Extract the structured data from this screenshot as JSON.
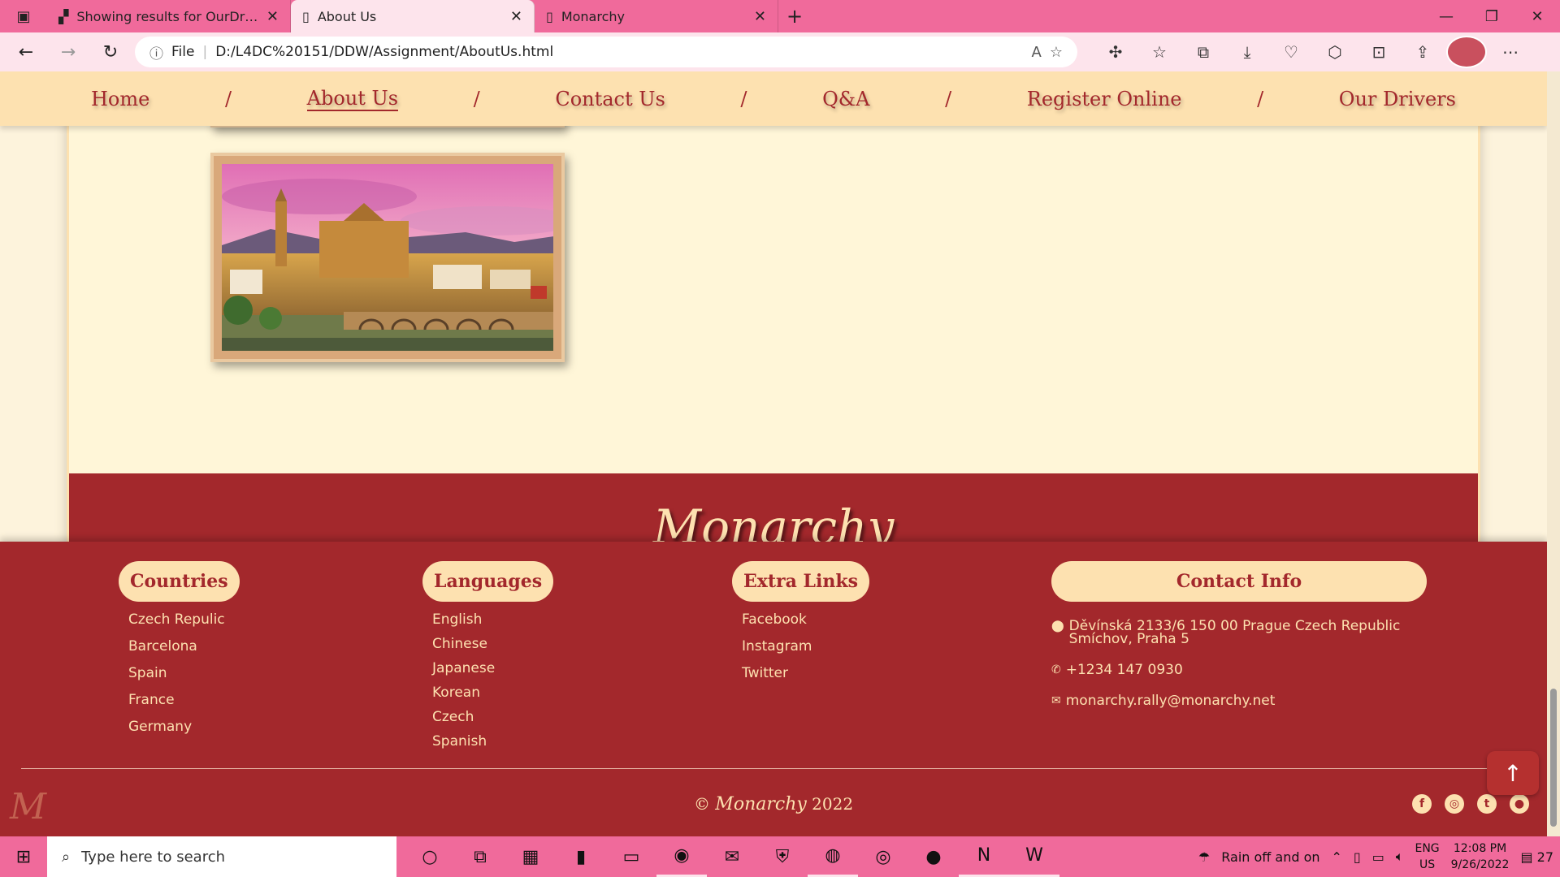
{
  "browser": {
    "tabs": [
      {
        "title": "Showing results for OurDrivers.h",
        "active": false
      },
      {
        "title": "About Us",
        "active": true
      },
      {
        "title": "Monarchy",
        "active": false
      }
    ],
    "address": {
      "label": "File",
      "url": "D:/L4DC%20151/DDW/Assignment/AboutUs.html"
    }
  },
  "nav": {
    "items": [
      "Home",
      "About Us",
      "Contact Us",
      "Q&A",
      "Register Online",
      "Our Drivers"
    ],
    "separator": "/",
    "current": "About Us"
  },
  "band": {
    "brand": "Monarchy"
  },
  "footer": {
    "countries": {
      "heading": "Countries",
      "items": [
        "Czech Repulic",
        "Barcelona",
        "Spain",
        "France",
        "Germany"
      ]
    },
    "languages": {
      "heading": "Languages",
      "items": [
        "English",
        "Chinese",
        "Japanese",
        "Korean",
        "Czech",
        "Spanish"
      ]
    },
    "links": {
      "heading": "Extra Links",
      "items": [
        "Facebook",
        "Instagram",
        "Twitter"
      ]
    },
    "contact": {
      "heading": "Contact Info",
      "address_line1": "Děvínská 2133/6 150 00 Prague Czech Republic",
      "address_line2": "Smíchov, Praha 5",
      "phone": "+1234 147 0930",
      "email": "monarchy.rally@monarchy.net"
    },
    "copyright": {
      "symbol": "©",
      "brand": "Monarchy",
      "year": "2022"
    },
    "logo": "M"
  },
  "taskbar": {
    "search_placeholder": "Type here to search",
    "weather": "Rain off and on",
    "lang_top": "ENG",
    "lang_bottom": "US",
    "time": "12:08 PM",
    "date": "9/26/2022",
    "notification_count": "27"
  },
  "colors": {
    "brand_red": "#a3282c",
    "cream": "#fde1b0",
    "chrome_pink": "#f06a9b"
  }
}
